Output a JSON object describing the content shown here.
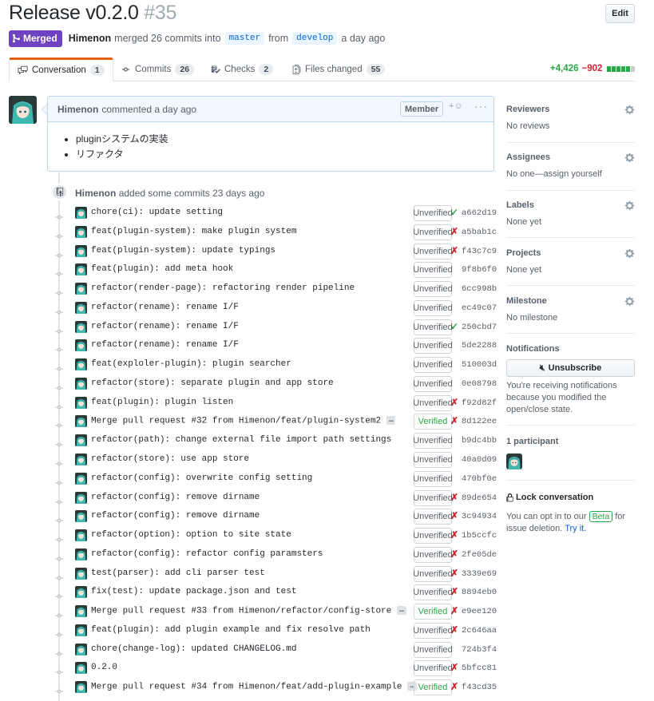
{
  "pr": {
    "title": "Release v0.2.0",
    "number": "#35",
    "edit_label": "Edit",
    "state_label": "Merged",
    "author": "Himenon",
    "merged_text": "merged 26 commits into",
    "base_branch": "master",
    "from_text": "from",
    "head_branch": "develop",
    "time_text": "a day ago"
  },
  "tabs": [
    {
      "label": "Conversation",
      "count": "1",
      "icon": "comment-discussion-icon"
    },
    {
      "label": "Commits",
      "count": "26",
      "icon": "git-commit-icon"
    },
    {
      "label": "Checks",
      "count": "2",
      "icon": "checklist-icon"
    },
    {
      "label": "Files changed",
      "count": "55",
      "icon": "file-diff-icon"
    }
  ],
  "diffstat": {
    "additions": "+4,426",
    "deletions": "−902",
    "blocks": [
      "#28a745",
      "#28a745",
      "#28a745",
      "#28a745",
      "#28a745",
      "#cccccc"
    ]
  },
  "comment": {
    "author": "Himenon",
    "meta": "commented a day ago",
    "role": "Member",
    "items": [
      "pluginシステムの実装",
      "リファクタ"
    ]
  },
  "commits_header": {
    "author": "Himenon",
    "text": "added some commits 23 days ago"
  },
  "commits": [
    {
      "message": "chore(ci): update setting",
      "verification": "Unverified",
      "status": "pass",
      "sha": "a662d19"
    },
    {
      "message": "feat(plugin-system): make plugin system",
      "verification": "Unverified",
      "status": "fail",
      "sha": "a5bab1c"
    },
    {
      "message": "feat(plugin-system): update typings",
      "verification": "Unverified",
      "status": "fail",
      "sha": "f43c7c9"
    },
    {
      "message": "feat(plugin): add meta hook",
      "verification": "Unverified",
      "status": "",
      "sha": "9f8b6f0"
    },
    {
      "message": "refactor(render-page): refactoring render pipeline",
      "verification": "Unverified",
      "status": "",
      "sha": "6cc998b"
    },
    {
      "message": "refactor(rename): rename I/F",
      "verification": "Unverified",
      "status": "",
      "sha": "ec49c07"
    },
    {
      "message": "refactor(rename): rename I/F",
      "verification": "Unverified",
      "status": "pass",
      "sha": "250cbd7"
    },
    {
      "message": "refactor(rename): rename I/F",
      "verification": "Unverified",
      "status": "",
      "sha": "5de2288"
    },
    {
      "message": "feat(exploler-plugin): plugin searcher",
      "verification": "Unverified",
      "status": "",
      "sha": "510003d"
    },
    {
      "message": "refactor(store): separate plugin and app store",
      "verification": "Unverified",
      "status": "",
      "sha": "0e08798"
    },
    {
      "message": "feat(plugin): plugin listen",
      "verification": "Unverified",
      "status": "fail",
      "sha": "f92d82f"
    },
    {
      "message": "Merge pull request #32 from Himenon/feat/plugin-system2",
      "verification": "Verified",
      "status": "fail",
      "sha": "8d122ee",
      "more": "…"
    },
    {
      "message": "refactor(path): change external file import path settings",
      "verification": "Unverified",
      "status": "",
      "sha": "b9dc4bb"
    },
    {
      "message": "refactor(store): use app store",
      "verification": "Unverified",
      "status": "",
      "sha": "40a0d09"
    },
    {
      "message": "refactor(config): overwrite config setting",
      "verification": "Unverified",
      "status": "",
      "sha": "470bf0e"
    },
    {
      "message": "refactor(config): remove dirname",
      "verification": "Unverified",
      "status": "fail",
      "sha": "89de654"
    },
    {
      "message": "refactor(config): remove dirname",
      "verification": "Unverified",
      "status": "fail",
      "sha": "3c94934"
    },
    {
      "message": "refactor(option): option to site state",
      "verification": "Unverified",
      "status": "fail",
      "sha": "1b5ccfc"
    },
    {
      "message": "refactor(config): refactor config paramsters",
      "verification": "Unverified",
      "status": "fail",
      "sha": "2fe05de"
    },
    {
      "message": "test(parser): add cli parser test",
      "verification": "Unverified",
      "status": "fail",
      "sha": "3339e69"
    },
    {
      "message": "fix(test): update package.json and test",
      "verification": "Unverified",
      "status": "fail",
      "sha": "8894eb0"
    },
    {
      "message": "Merge pull request #33 from Himenon/refactor/config-store",
      "verification": "Verified",
      "status": "fail",
      "sha": "e9ee120",
      "more": "…"
    },
    {
      "message": "feat(plugin): add plugin example and fix resolve path",
      "verification": "Unverified",
      "status": "fail",
      "sha": "2c646aa"
    },
    {
      "message": "chore(change-log): updated CHANGELOG.md",
      "verification": "Unverified",
      "status": "",
      "sha": "724b3f4"
    },
    {
      "message": "0.2.0",
      "verification": "Unverified",
      "status": "fail",
      "sha": "5bfcc81"
    },
    {
      "message": "Merge pull request #34 from Himenon/feat/add-plugin-example",
      "verification": "Verified",
      "status": "fail",
      "sha": "f43cd35",
      "more": "…"
    }
  ],
  "sidebar": {
    "reviewers": {
      "title": "Reviewers",
      "value": "No reviews"
    },
    "assignees": {
      "title": "Assignees",
      "value": "No one—assign yourself"
    },
    "labels": {
      "title": "Labels",
      "value": "None yet"
    },
    "projects": {
      "title": "Projects",
      "value": "None yet"
    },
    "milestone": {
      "title": "Milestone",
      "value": "No milestone"
    },
    "notifications": {
      "title": "Notifications",
      "button": "Unsubscribe",
      "text": "You're receiving notifications because you modified the open/close state."
    },
    "participants": {
      "title": "1 participant"
    },
    "lock": {
      "title": "Lock conversation",
      "text_before": "You can opt in to our",
      "beta": "Beta",
      "text_after": "for issue deletion.",
      "link": "Try it."
    }
  },
  "colors": {
    "merged": "#6f42c1",
    "success": "#28a745",
    "danger": "#cb2431",
    "link": "#0366d6"
  }
}
